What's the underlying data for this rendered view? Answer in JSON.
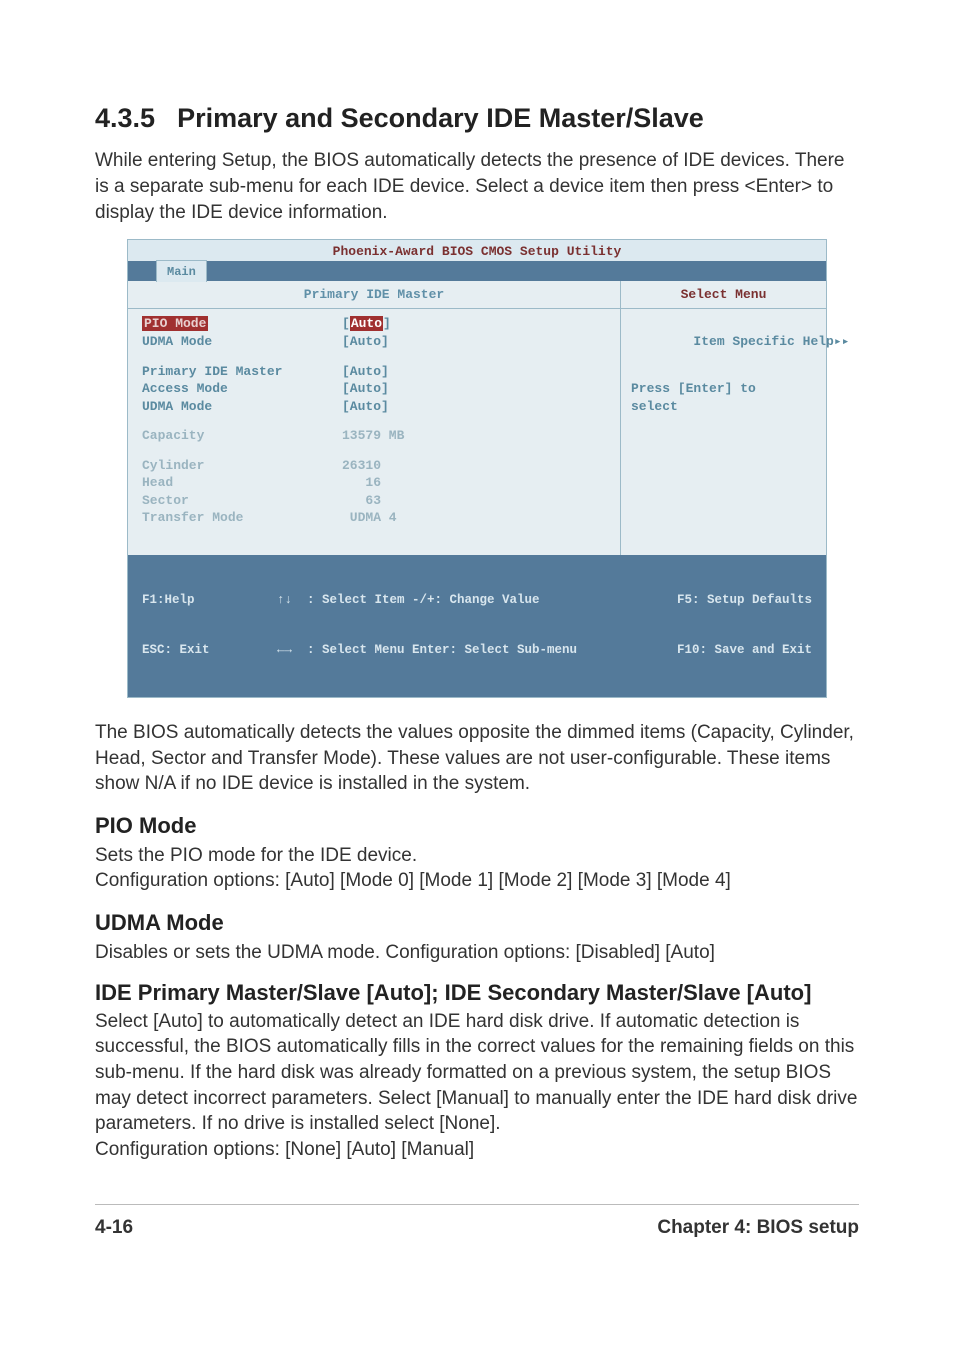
{
  "section": {
    "number": "4.3.5",
    "title": "Primary and Secondary IDE Master/Slave"
  },
  "intro": "While entering Setup, the BIOS automatically detects the presence of IDE devices. There is a separate sub-menu for each IDE device. Select a device item then press <Enter> to display the IDE device information.",
  "bios": {
    "utility_title": "Phoenix-Award BIOS CMOS Setup Utility",
    "tab": "Main",
    "panel_title": "Primary IDE Master",
    "right_title": "Select Menu",
    "help_header": "Item Specific Help",
    "help_arrows": "▸▸",
    "help_line1": "Press [Enter] to",
    "help_line2": "select",
    "rows": {
      "pio_mode": {
        "label": "PIO Mode",
        "value": "Auto"
      },
      "udma_mode1": {
        "label": "UDMA Mode",
        "value": "[Auto]"
      },
      "prim_ide_master": {
        "label": "Primary IDE Master",
        "value": "[Auto]"
      },
      "access_mode": {
        "label": "Access Mode",
        "value": "[Auto]"
      },
      "udma_mode2": {
        "label": "UDMA Mode",
        "value": "[Auto]"
      },
      "capacity": {
        "label": "Capacity",
        "value": "13579 MB"
      },
      "cylinder": {
        "label": "Cylinder",
        "value": "26310"
      },
      "head": {
        "label": "Head",
        "value": "   16"
      },
      "sector": {
        "label": "Sector",
        "value": "   63"
      },
      "transfer": {
        "label": "Transfer Mode",
        "value": " UDMA 4"
      }
    },
    "footer": {
      "f1": "F1:Help",
      "esc": "ESC: Exit",
      "arrows1": "↑↓  : Select Item",
      "arrows2": "←→  : Select Menu",
      "change": "-/+: Change Value",
      "enter": "Enter: Select Sub-menu",
      "f5": "F5: Setup Defaults",
      "f10": "F10: Save and Exit"
    }
  },
  "after_bios": "The BIOS automatically detects the values opposite the dimmed items (Capacity, Cylinder,  Head, Sector and Transfer Mode). These values are not user-configurable. These items show N/A if no IDE device is installed in the system.",
  "pio": {
    "title": "PIO Mode",
    "line1": "Sets the PIO mode for the IDE device.",
    "line2": "Configuration options: [Auto] [Mode 0] [Mode 1] [Mode 2] [Mode 3] [Mode 4]"
  },
  "udma": {
    "title": "UDMA Mode",
    "line1": "Disables or sets the UDMA mode. Configuration options: [Disabled] [Auto]"
  },
  "ide": {
    "title": "IDE Primary Master/Slave [Auto]; IDE Secondary Master/Slave [Auto]",
    "body": "Select [Auto] to automatically detect an IDE hard disk drive. If automatic detection is successful, the BIOS automatically fills in the correct values for the remaining fields on this sub-menu. If the hard disk was already formatted on a previous system, the setup BIOS may detect incorrect parameters. Select [Manual] to manually enter the IDE hard disk drive parameters. If no drive is installed select [None].",
    "config": "Configuration options: [None] [Auto] [Manual]"
  },
  "footer": {
    "page": "4-16",
    "chapter": "Chapter 4: BIOS setup"
  }
}
